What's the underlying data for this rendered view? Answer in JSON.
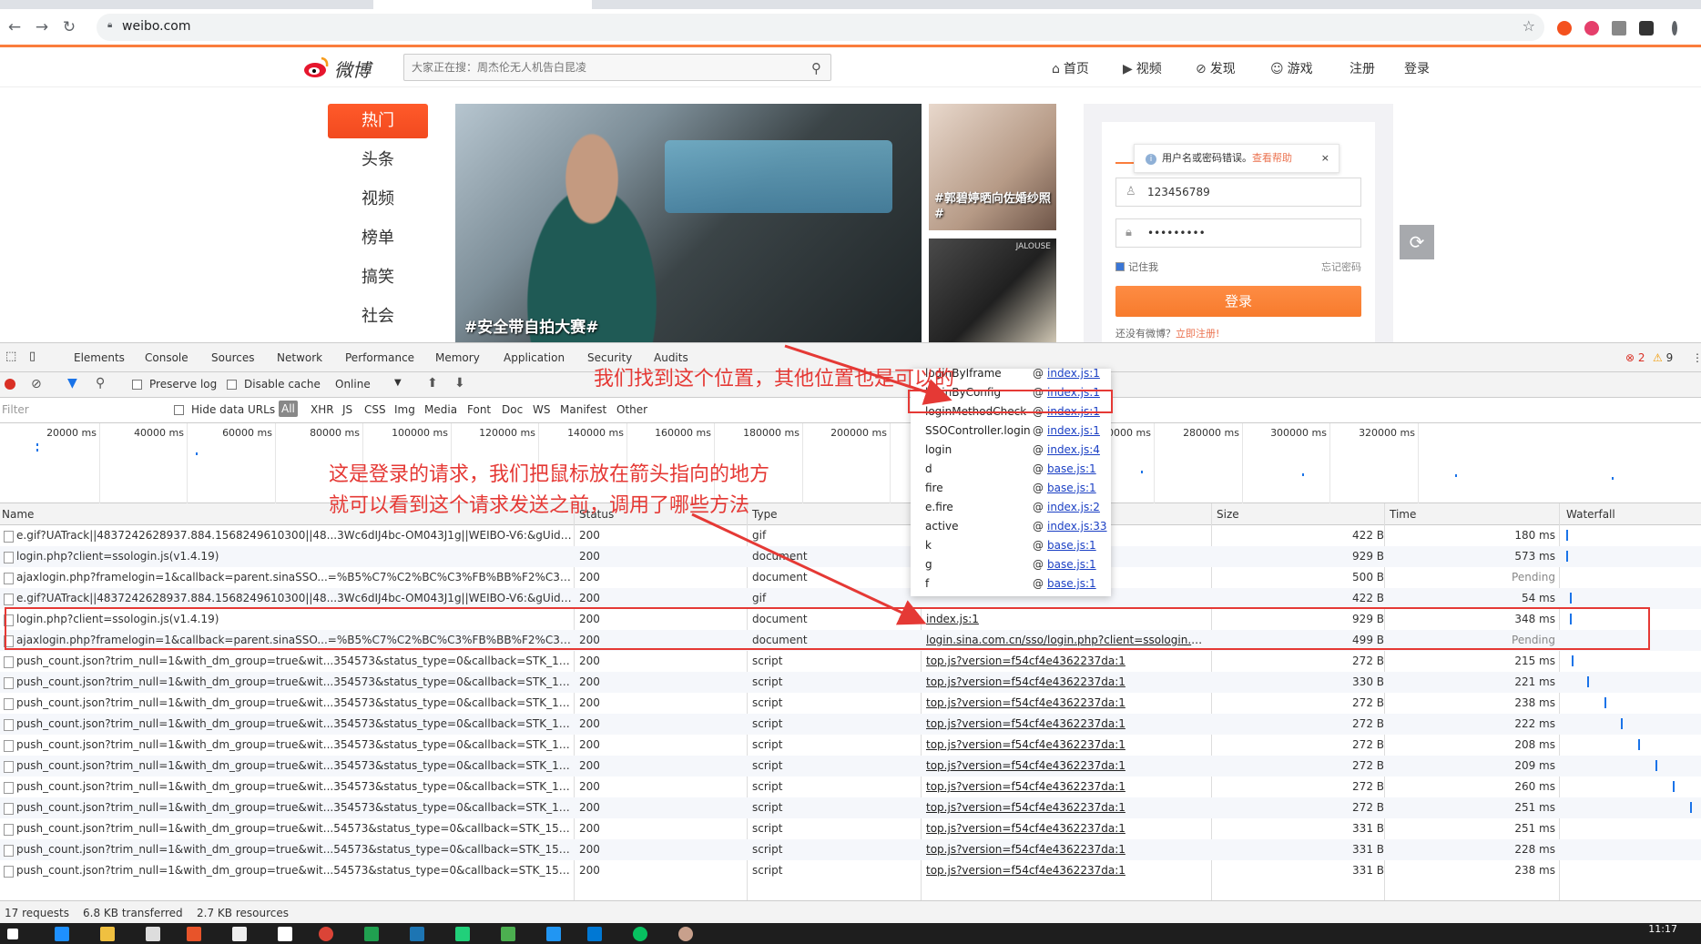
{
  "browser": {
    "url": "weibo.com"
  },
  "weibo": {
    "logo_text": "微博",
    "search_placeholder": "大家正在搜：周杰伦无人机告白昆凌",
    "nav": [
      {
        "label": "首页",
        "icon": "home-icon"
      },
      {
        "label": "视频",
        "icon": "video-icon"
      },
      {
        "label": "发现",
        "icon": "compass-icon"
      },
      {
        "label": "游戏",
        "icon": "game-icon"
      },
      {
        "label": "注册"
      },
      {
        "label": "登录"
      }
    ],
    "left_nav": [
      "热门",
      "头条",
      "视频",
      "榜单",
      "搞笑",
      "社会"
    ],
    "photo_main_caption": "#安全带自拍大赛#",
    "photo_a_caption": "#郭碧婷晒向佐婚纱照#",
    "photo_b_tag": "JALOUSE",
    "login": {
      "tip_text": "用户名或密码错误。",
      "tip_help": "查看帮助",
      "username_value": "123456789",
      "password_value": "•••••••••",
      "remember": "记住我",
      "forget": "忘记密码",
      "button": "登录",
      "no_account": "还没有微博？",
      "register": "立即注册!"
    }
  },
  "devtools": {
    "tabs": [
      "Elements",
      "Console",
      "Sources",
      "Network",
      "Performance",
      "Memory",
      "Application",
      "Security",
      "Audits"
    ],
    "active_tab": "Network",
    "errors": "2",
    "warnings": "9",
    "toolbar": {
      "preserve_log": "Preserve log",
      "disable_cache": "Disable cache",
      "throttle": "Online"
    },
    "filter": {
      "placeholder": "Filter",
      "hide_data_urls": "Hide data URLs",
      "types": [
        "All",
        "XHR",
        "JS",
        "CSS",
        "Img",
        "Media",
        "Font",
        "Doc",
        "WS",
        "Manifest",
        "Other"
      ]
    },
    "timeline_ticks": [
      "20000 ms",
      "40000 ms",
      "60000 ms",
      "80000 ms",
      "100000 ms",
      "120000 ms",
      "140000 ms",
      "160000 ms",
      "180000 ms",
      "200000 ms",
      "220000 ms",
      "240000 ms",
      "260000 ms",
      "280000 ms",
      "300000 ms",
      "320000 ms"
    ],
    "columns": [
      "Name",
      "Status",
      "Type",
      "Initiator",
      "Size",
      "Time",
      "Waterfall"
    ],
    "rows": [
      {
        "name": "e.gif?UATrack||4837242628937.884.1568249610300||48...3Wc6dIJ4bc-OM043J1g||WEIBO-V6:&gUid_156...",
        "status": "200",
        "type": "gif",
        "initiator": "",
        "size": "422 B",
        "time": "180 ms"
      },
      {
        "name": "login.php?client=ssologin.js(v1.4.19)",
        "status": "200",
        "type": "document",
        "initiator": "",
        "size": "929 B",
        "time": "573 ms"
      },
      {
        "name": "ajaxlogin.php?framelogin=1&callback=parent.sinaSSO...=%B5%C7%C2%BC%C3%FB%BB%F2%C3%DC...",
        "status": "200",
        "type": "document",
        "initiator": "ent=ssologin.js(...",
        "size": "500 B",
        "time": "Pending"
      },
      {
        "name": "e.gif?UATrack||4837242628937.884.1568249610300||48...3Wc6dIJ4bc-OM043J1g||WEIBO-V6:&gUid_156...",
        "status": "200",
        "type": "gif",
        "initiator": "",
        "size": "422 B",
        "time": "54 ms"
      },
      {
        "name": "login.php?client=ssologin.js(v1.4.19)",
        "status": "200",
        "type": "document",
        "initiator": "index.js:1",
        "size": "929 B",
        "time": "348 ms"
      },
      {
        "name": "ajaxlogin.php?framelogin=1&callback=parent.sinaSSO...=%B5%C7%C2%BC%C3%FB%BB%F2%C3%DC...",
        "status": "200",
        "type": "document",
        "initiator": "login.sina.com.cn/sso/login.php?client=ssologin.js(...",
        "size": "499 B",
        "time": "Pending"
      },
      {
        "name": "push_count.json?trim_null=1&with_dm_group=true&wit...354573&status_type=0&callback=STK_1568...",
        "status": "200",
        "type": "script",
        "initiator": "top.js?version=f54cf4e4362237da:1",
        "size": "272 B",
        "time": "215 ms"
      },
      {
        "name": "push_count.json?trim_null=1&with_dm_group=true&wit...354573&status_type=0&callback=STK_1568...",
        "status": "200",
        "type": "script",
        "initiator": "top.js?version=f54cf4e4362237da:1",
        "size": "330 B",
        "time": "221 ms"
      },
      {
        "name": "push_count.json?trim_null=1&with_dm_group=true&wit...354573&status_type=0&callback=STK_1568...",
        "status": "200",
        "type": "script",
        "initiator": "top.js?version=f54cf4e4362237da:1",
        "size": "272 B",
        "time": "238 ms"
      },
      {
        "name": "push_count.json?trim_null=1&with_dm_group=true&wit...354573&status_type=0&callback=STK_1568...",
        "status": "200",
        "type": "script",
        "initiator": "top.js?version=f54cf4e4362237da:1",
        "size": "272 B",
        "time": "222 ms"
      },
      {
        "name": "push_count.json?trim_null=1&with_dm_group=true&wit...354573&status_type=0&callback=STK_1568...",
        "status": "200",
        "type": "script",
        "initiator": "top.js?version=f54cf4e4362237da:1",
        "size": "272 B",
        "time": "208 ms"
      },
      {
        "name": "push_count.json?trim_null=1&with_dm_group=true&wit...354573&status_type=0&callback=STK_1568...",
        "status": "200",
        "type": "script",
        "initiator": "top.js?version=f54cf4e4362237da:1",
        "size": "272 B",
        "time": "209 ms"
      },
      {
        "name": "push_count.json?trim_null=1&with_dm_group=true&wit...354573&status_type=0&callback=STK_1568...",
        "status": "200",
        "type": "script",
        "initiator": "top.js?version=f54cf4e4362237da:1",
        "size": "272 B",
        "time": "260 ms"
      },
      {
        "name": "push_count.json?trim_null=1&with_dm_group=true&wit...354573&status_type=0&callback=STK_1568...",
        "status": "200",
        "type": "script",
        "initiator": "top.js?version=f54cf4e4362237da:1",
        "size": "272 B",
        "time": "251 ms"
      },
      {
        "name": "push_count.json?trim_null=1&with_dm_group=true&wit...54573&status_type=0&callback=STK_15682...",
        "status": "200",
        "type": "script",
        "initiator": "top.js?version=f54cf4e4362237da:1",
        "size": "331 B",
        "time": "251 ms"
      },
      {
        "name": "push_count.json?trim_null=1&with_dm_group=true&wit...54573&status_type=0&callback=STK_15682...",
        "status": "200",
        "type": "script",
        "initiator": "top.js?version=f54cf4e4362237da:1",
        "size": "331 B",
        "time": "228 ms"
      },
      {
        "name": "push_count.json?trim_null=1&with_dm_group=true&wit...54573&status_type=0&callback=STK_15682...",
        "status": "200",
        "type": "script",
        "initiator": "top.js?version=f54cf4e4362237da:1",
        "size": "331 B",
        "time": "238 ms"
      }
    ],
    "initiator_stack": [
      {
        "fn": "loginByIframe",
        "src": "index.js:1"
      },
      {
        "fn": "loginByConfig",
        "src": "index.js:1"
      },
      {
        "fn": "loginMethodCheck",
        "src": "index.js:1"
      },
      {
        "fn": "SSOController.login",
        "src": "index.js:1"
      },
      {
        "fn": "login",
        "src": "index.js:4"
      },
      {
        "fn": "d",
        "src": "base.js:1"
      },
      {
        "fn": "fire",
        "src": "base.js:1"
      },
      {
        "fn": "e.fire",
        "src": "index.js:2"
      },
      {
        "fn": "active",
        "src": "index.js:33"
      },
      {
        "fn": "k",
        "src": "base.js:1"
      },
      {
        "fn": "g",
        "src": "base.js:1"
      },
      {
        "fn": "f",
        "src": "base.js:1"
      }
    ],
    "status": {
      "requests": "17 requests",
      "transferred": "6.8 KB transferred",
      "resources": "2.7 KB resources"
    }
  },
  "annotations": {
    "top": "我们找到这个位置，其他位置也是可以的",
    "middle_line1": "这是登录的请求，我们把鼠标放在箭头指向的地方",
    "middle_line2": "就可以看到这个请求发送之前，调用了哪些方法"
  },
  "taskbar": {
    "time": "11:17"
  },
  "colors": {
    "accent": "#fa7d3c",
    "annotation": "#e53935",
    "devtools_blue": "#1a73e8"
  }
}
